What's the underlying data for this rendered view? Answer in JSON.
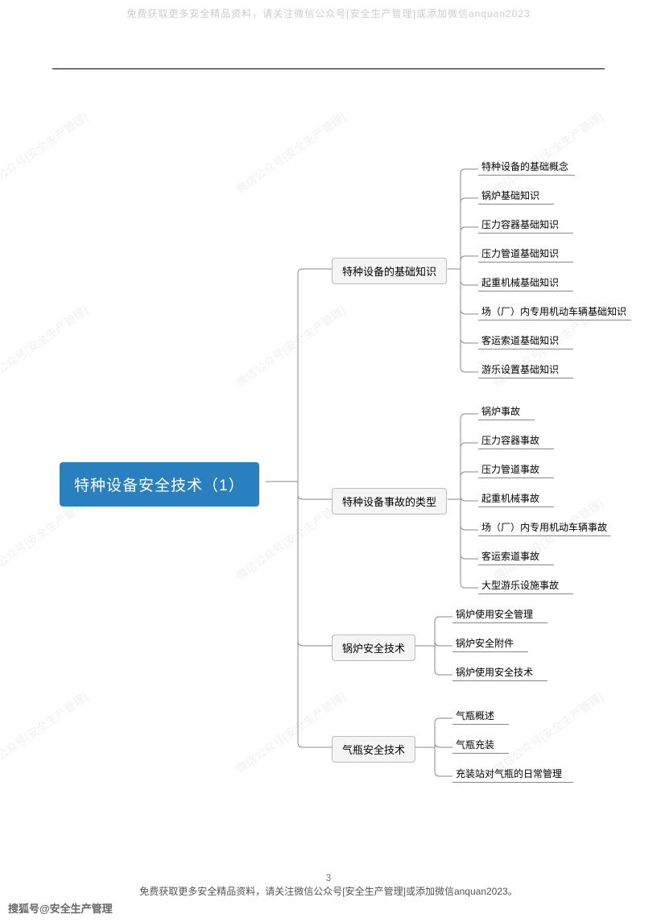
{
  "watermark_top": "免费获取更多安全精品资料，请关注微信公众号[安全生产管理]或添加微信anquan2023",
  "diagonal_watermark": "微信公众号[安全生产管理]",
  "root": "特种设备安全技术（1）",
  "branches": [
    {
      "label": "特种设备的基础知识",
      "leaves": [
        "特种设备的基础概念",
        "锅炉基础知识",
        "压力容器基础知识",
        "压力管道基础知识",
        "起重机械基础知识",
        "场（厂）内专用机动车辆基础知识",
        "客运索道基础知识",
        "游乐设置基础知识"
      ]
    },
    {
      "label": "特种设备事故的类型",
      "leaves": [
        "锅炉事故",
        "压力容器事故",
        "压力管道事故",
        "起重机械事故",
        "场（厂）内专用机动车辆事故",
        "客运索道事故",
        "大型游乐设施事故"
      ]
    },
    {
      "label": "锅炉安全技术",
      "leaves": [
        "锅炉使用安全管理",
        "锅炉安全附件",
        "锅炉使用安全技术"
      ]
    },
    {
      "label": "气瓶安全技术",
      "leaves": [
        "气瓶概述",
        "气瓶充装",
        "充装站对气瓶的日常管理"
      ]
    }
  ],
  "page_number": "3",
  "footer": "免费获取更多安全精品资料，请关注微信公众号[安全生产管理]或添加微信anquan2023。",
  "sohu_credit": "搜狐号@安全生产管理",
  "colors": {
    "root_bg": "#2a7fbf",
    "branch_bg": "#f5f5f5",
    "branch_border": "#bbb"
  }
}
